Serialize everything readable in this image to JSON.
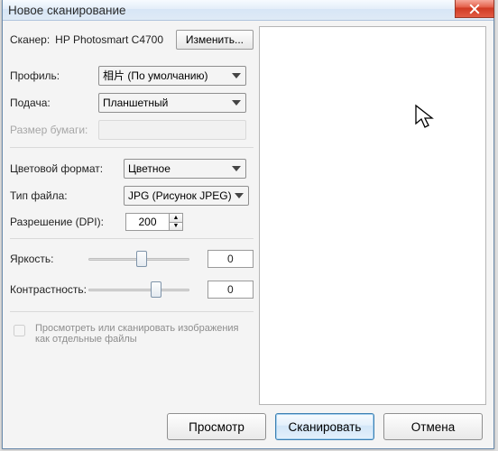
{
  "window": {
    "title": "Новое сканирование"
  },
  "scanner": {
    "label": "Сканер:",
    "name": "HP Photosmart C4700",
    "change_btn": "Изменить..."
  },
  "profile": {
    "label": "Профиль:",
    "value": "相片 (По умолчанию)"
  },
  "feed": {
    "label": "Подача:",
    "value": "Планшетный"
  },
  "papersize": {
    "label": "Размер бумаги:",
    "value": ""
  },
  "colorformat": {
    "label": "Цветовой формат:",
    "value": "Цветное"
  },
  "filetype": {
    "label": "Тип файла:",
    "value": "JPG (Рисунок JPEG)"
  },
  "resolution": {
    "label": "Разрешение (DPI):",
    "value": "200"
  },
  "brightness": {
    "label": "Яркость:",
    "value": "0"
  },
  "contrast": {
    "label": "Контрастность:",
    "value": "0"
  },
  "separate": {
    "label": "Просмотреть или сканировать изображения как отдельные файлы"
  },
  "buttons": {
    "preview": "Просмотр",
    "scan": "Сканировать",
    "cancel": "Отмена"
  }
}
